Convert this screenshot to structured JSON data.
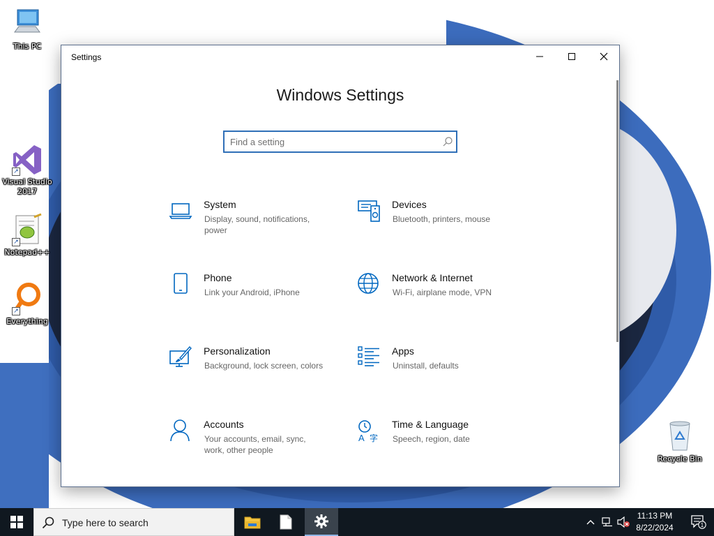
{
  "desktop": {
    "icons": [
      {
        "label": "This PC",
        "icon": "this-pc-icon"
      },
      {
        "label": "Visual Studio 2017",
        "icon": "visual-studio-icon"
      },
      {
        "label": "Notepad++",
        "icon": "notepad-plus-plus-icon"
      },
      {
        "label": "Everything",
        "icon": "everything-search-icon"
      },
      {
        "label": "Recycle Bin",
        "icon": "recycle-bin-icon"
      }
    ]
  },
  "window": {
    "title": "Settings",
    "heading": "Windows Settings",
    "search": {
      "placeholder": "Find a setting"
    },
    "tiles": [
      {
        "name": "System",
        "desc": "Display, sound, notifications, power",
        "icon": "laptop-icon"
      },
      {
        "name": "Devices",
        "desc": "Bluetooth, printers, mouse",
        "icon": "devices-icon"
      },
      {
        "name": "Phone",
        "desc": "Link your Android, iPhone",
        "icon": "phone-icon"
      },
      {
        "name": "Network & Internet",
        "desc": "Wi-Fi, airplane mode, VPN",
        "icon": "globe-icon"
      },
      {
        "name": "Personalization",
        "desc": "Background, lock screen, colors",
        "icon": "paintbrush-icon"
      },
      {
        "name": "Apps",
        "desc": "Uninstall, defaults",
        "icon": "apps-list-icon"
      },
      {
        "name": "Accounts",
        "desc": "Your accounts, email, sync, work, other people",
        "icon": "person-icon"
      },
      {
        "name": "Time & Language",
        "desc": "Speech, region, date",
        "icon": "time-language-icon"
      }
    ]
  },
  "taskbar": {
    "search_text": "Type here to search",
    "time": "11:13 PM",
    "date": "8/22/2024",
    "notification_count": "1"
  },
  "colors": {
    "accent": "#0067c0",
    "taskbar": "#101820",
    "wallpaper_blue": "#3c6cbd"
  }
}
